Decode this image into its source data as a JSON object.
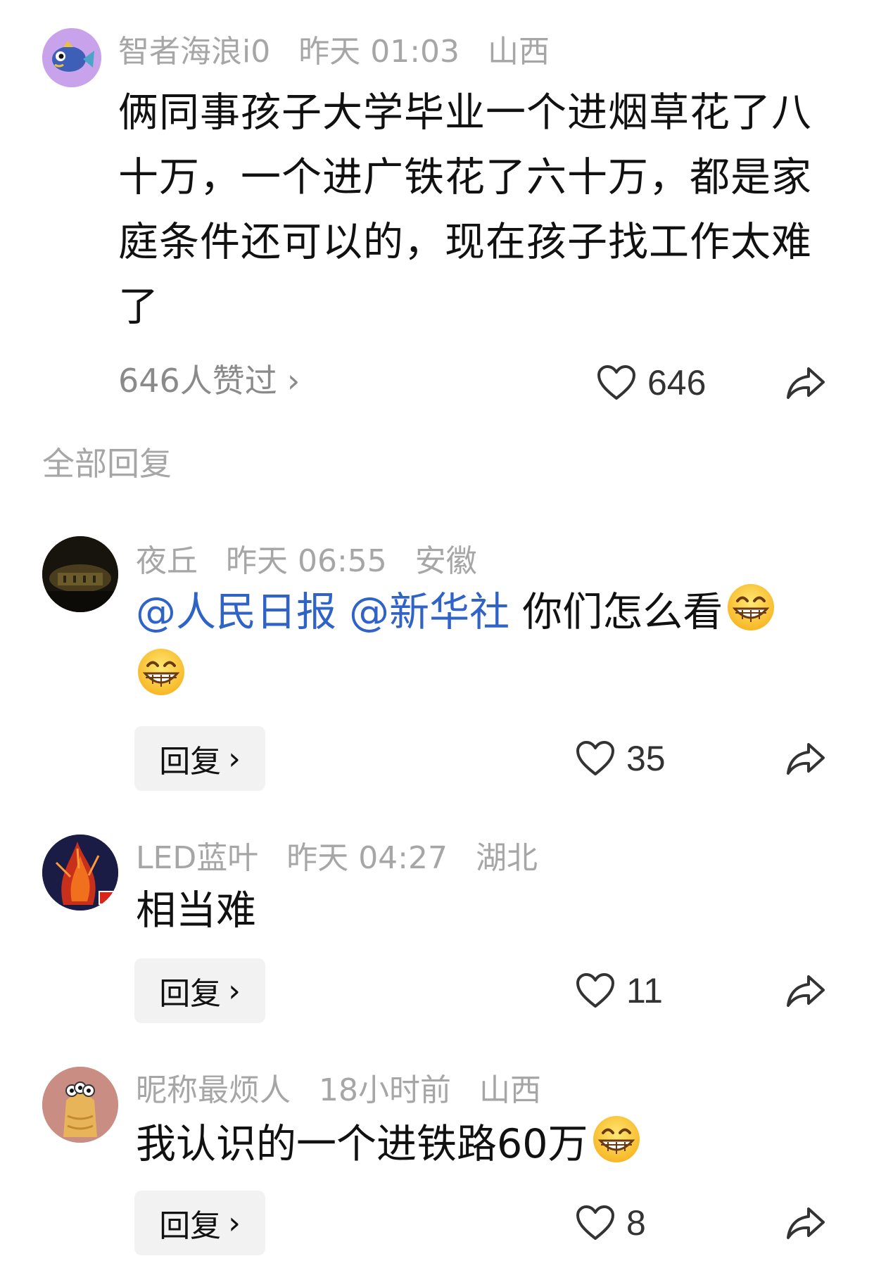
{
  "post": {
    "username": "智者海浪i0",
    "time": "昨天 01:03",
    "location": "山西",
    "text": "俩同事孩子大学毕业一个进烟草花了八十万，一个进广铁花了六十万，都是家庭条件还可以的，现在孩子找工作太难了",
    "likes_link": "646人赞过",
    "like_count": "646"
  },
  "section_title": "全部回复",
  "reply_label": "回复",
  "comments": [
    {
      "username": "夜丘",
      "time": "昨天 06:55",
      "location": "安徽",
      "mention_1": "@人民日报",
      "mention_2": "@新华社",
      "text": "你们怎么看",
      "like_count": "35"
    },
    {
      "username": "LED蓝叶",
      "time": "昨天 04:27",
      "location": "湖北",
      "text": "相当难",
      "like_count": "11"
    },
    {
      "username": "昵称最烦人",
      "time": "18小时前",
      "location": "山西",
      "text": "我认识的一个进铁路60万",
      "like_count": "8"
    }
  ],
  "icons": {
    "heart": "heart-outline-icon",
    "share": "share-arrow-icon",
    "chevron": "chevron-right-icon",
    "emoji": "grinning-emoji"
  },
  "colors": {
    "mention": "#2f63c8",
    "meta": "#a6a6a6",
    "reply_bg": "#f2f2f2"
  }
}
